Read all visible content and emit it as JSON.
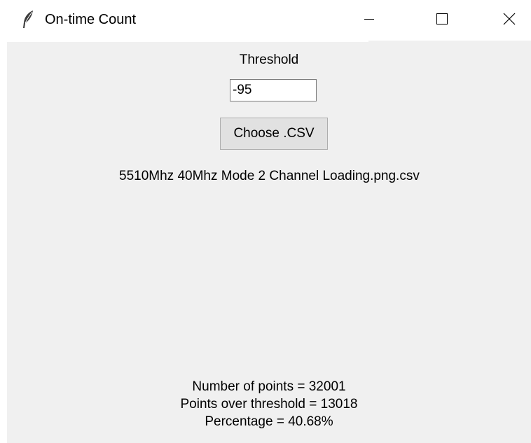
{
  "window": {
    "title": "On-time Count",
    "icon": "feather-icon",
    "controls": [
      "minimize-icon",
      "maximize-icon",
      "close-icon"
    ]
  },
  "threshold": {
    "label": "Threshold",
    "value": "-95"
  },
  "choose_button": {
    "label": "Choose .CSV"
  },
  "file": {
    "name": "5510Mhz 40Mhz Mode 2 Channel Loading.png.csv"
  },
  "results": {
    "points": "Number of points = 32001",
    "over_threshold": "Points over threshold = 13018",
    "percentage": "Percentage = 40.68%"
  }
}
